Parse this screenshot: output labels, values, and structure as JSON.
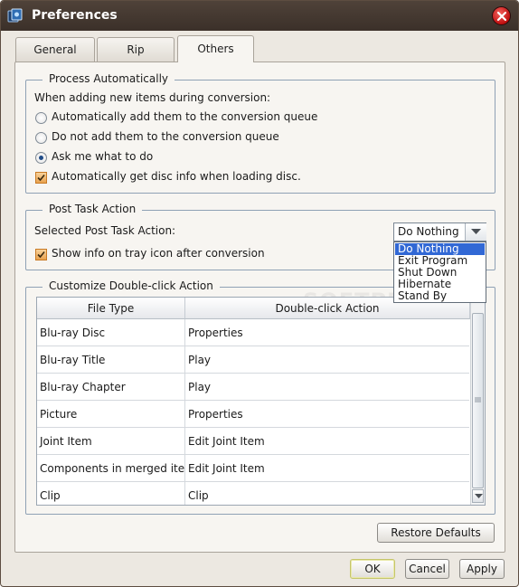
{
  "window": {
    "title": "Preferences"
  },
  "tabs": [
    {
      "label": "General"
    },
    {
      "label": "Rip"
    },
    {
      "label": "Others"
    }
  ],
  "process_automatically": {
    "legend": "Process Automatically",
    "prompt": "When adding new items during conversion:",
    "options": [
      {
        "label": "Automatically add them to the conversion queue",
        "selected": false
      },
      {
        "label": "Do not add them to the conversion queue",
        "selected": false
      },
      {
        "label": "Ask me what to do",
        "selected": true
      }
    ],
    "disc_info_checkbox": {
      "label": "Automatically get disc info when loading disc.",
      "checked": true
    }
  },
  "post_task": {
    "legend": "Post Task Action",
    "selected_label": "Selected Post Task Action:",
    "selected_value": "Do Nothing",
    "options": [
      "Do Nothing",
      "Exit Program",
      "Shut Down",
      "Hibernate",
      "Stand By"
    ],
    "tray_checkbox": {
      "label": "Show info on tray icon after conversion",
      "checked": true
    }
  },
  "double_click": {
    "legend": "Customize Double-click Action",
    "columns": [
      "File Type",
      "Double-click Action"
    ],
    "rows": [
      {
        "file_type": "Blu-ray Disc",
        "action": "Properties"
      },
      {
        "file_type": "Blu-ray Title",
        "action": "Play"
      },
      {
        "file_type": "Blu-ray Chapter",
        "action": "Play"
      },
      {
        "file_type": "Picture",
        "action": "Properties"
      },
      {
        "file_type": "Joint Item",
        "action": "Edit Joint Item"
      },
      {
        "file_type": "Components in merged items",
        "action": "Edit Joint Item"
      },
      {
        "file_type": "Clip",
        "action": "Clip"
      }
    ]
  },
  "buttons": {
    "restore_defaults": "Restore Defaults",
    "ok": "OK",
    "cancel": "Cancel",
    "apply": "Apply"
  },
  "watermark": "SOFTPEDIA",
  "colors": {
    "titlebar": "#3b3029",
    "selection": "#3168d5",
    "checkbox": "#e8a24f",
    "close": "#c01010"
  }
}
